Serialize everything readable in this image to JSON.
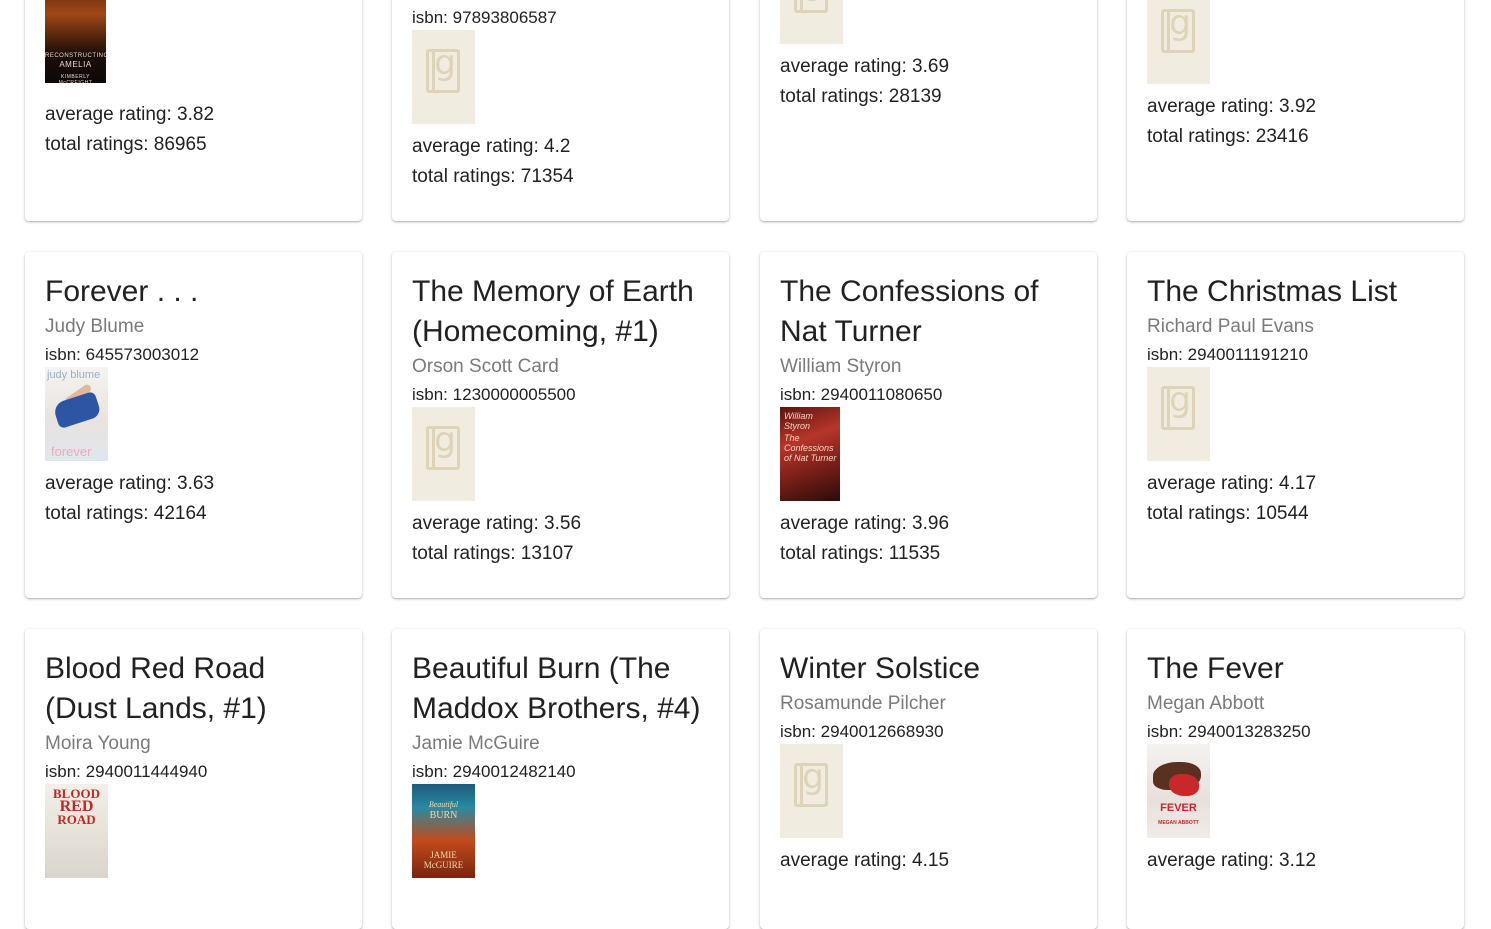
{
  "labels": {
    "isbn_prefix": "isbn:",
    "avg_prefix": "average rating:",
    "total_prefix": "total ratings:"
  },
  "books": [
    {
      "title": "",
      "author": "",
      "isbn": "",
      "cover": "amelia",
      "cover_text": [
        "RECONSTRUCTING",
        "AMELIA",
        "KIMBERLY McCREIGHT"
      ],
      "average_rating": "3.82",
      "total_ratings": "86965"
    },
    {
      "title": "",
      "author": "",
      "isbn": "97893806587",
      "cover": "placeholder",
      "average_rating": "4.2",
      "total_ratings": "71354"
    },
    {
      "title": "",
      "author": "",
      "isbn": "",
      "cover": "placeholder",
      "average_rating": "3.69",
      "total_ratings": "28139"
    },
    {
      "title": "",
      "author": "",
      "isbn": "",
      "cover": "placeholder",
      "average_rating": "3.92",
      "total_ratings": "23416"
    },
    {
      "title": "Forever . . .",
      "author": "Judy Blume",
      "isbn": "645573003012",
      "cover": "forever",
      "cover_text": [
        "judy blume",
        "forever"
      ],
      "average_rating": "3.63",
      "total_ratings": "42164"
    },
    {
      "title": "The Memory of Earth (Homecoming, #1)",
      "author": "Orson Scott Card",
      "isbn": "1230000005500",
      "cover": "placeholder",
      "average_rating": "3.56",
      "total_ratings": "13107"
    },
    {
      "title": "The Confessions of Nat Turner",
      "author": "William Styron",
      "isbn": "2940011080650",
      "cover": "nat",
      "cover_text": [
        "William Styron",
        "The Confessions of Nat Turner"
      ],
      "average_rating": "3.96",
      "total_ratings": "11535"
    },
    {
      "title": "The Christmas List",
      "author": "Richard Paul Evans",
      "isbn": "2940011191210",
      "cover": "placeholder",
      "average_rating": "4.17",
      "total_ratings": "10544"
    },
    {
      "title": "Blood Red Road (Dust Lands, #1)",
      "author": "Moira Young",
      "isbn": "2940011444940",
      "cover": "blood",
      "cover_text": [
        "BLOOD",
        "RED",
        "ROAD"
      ],
      "average_rating": "",
      "total_ratings": ""
    },
    {
      "title": "Beautiful Burn (The Maddox Brothers, #4)",
      "author": "Jamie McGuire",
      "isbn": "2940012482140",
      "cover": "beautiful",
      "cover_text": [
        "Beautiful",
        "BURN",
        "JAMIE",
        "McGUIRE"
      ],
      "average_rating": "",
      "total_ratings": ""
    },
    {
      "title": "Winter Solstice",
      "author": "Rosamunde Pilcher",
      "isbn": "2940012668930",
      "cover": "placeholder",
      "average_rating": "4.15",
      "total_ratings": ""
    },
    {
      "title": "The Fever",
      "author": "Megan Abbott",
      "isbn": "2940013283250",
      "cover": "fever",
      "cover_text": [
        "FEVER",
        "MEGAN ABBOTT"
      ],
      "average_rating": "3.12",
      "total_ratings": ""
    }
  ]
}
